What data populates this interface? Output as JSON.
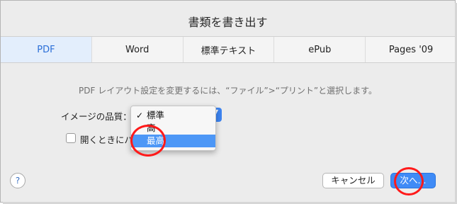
{
  "dialog": {
    "title": "書類を書き出す",
    "description": "PDF レイアウト設定を変更するには、“ファイル”>“プリント”と選択します。"
  },
  "tabs": [
    {
      "label": "PDF",
      "active": true
    },
    {
      "label": "Word",
      "active": false
    },
    {
      "label": "標準テキスト",
      "active": false
    },
    {
      "label": "ePub",
      "active": false
    },
    {
      "label": "Pages '09",
      "active": false
    }
  ],
  "image_quality": {
    "label": "イメージの品質：",
    "selected": "最高",
    "options": [
      {
        "label": "標準",
        "checked": true
      },
      {
        "label": "高",
        "checked": false
      },
      {
        "label": "最高",
        "checked": false,
        "highlighted": true
      }
    ],
    "check_glyph": "✓",
    "arrows_glyph": "▲▼"
  },
  "checkbox": {
    "label": "開くときにパ",
    "checked": false
  },
  "help": {
    "glyph": "?"
  },
  "buttons": {
    "cancel_label": "キャンセル",
    "next_label": "次へ..."
  },
  "colors": {
    "accent": "#3f8bf6",
    "active_tab_text": "#2b6fd8",
    "highlight": "#4d97f6",
    "annotation_circle": "#ff1a1a"
  }
}
